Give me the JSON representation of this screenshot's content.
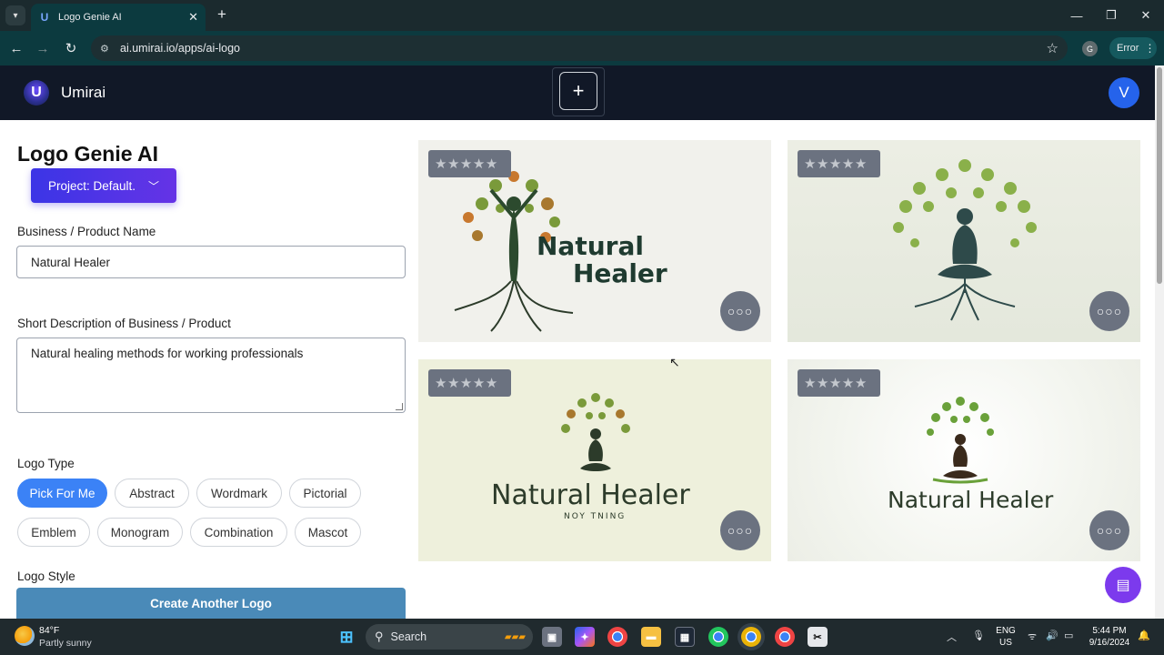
{
  "browser": {
    "tab_title": "Logo Genie AI",
    "url": "ai.umirai.io/apps/ai-logo",
    "profile_initial": "G",
    "error_label": "Error"
  },
  "header": {
    "brand": "Umirai",
    "brand_mark": "U",
    "new_label": "+",
    "avatar_initial": "V"
  },
  "form": {
    "title": "Logo Genie AI",
    "project_label": "Project: Default.",
    "name_label": "Business / Product Name",
    "name_value": "Natural Healer",
    "desc_label": "Short Description of Business / Product",
    "desc_value": "Natural healing methods for working professionals",
    "type_label": "Logo Type",
    "types": [
      "Pick For Me",
      "Abstract",
      "Wordmark",
      "Pictorial",
      "Emblem",
      "Monogram",
      "Combination",
      "Mascot"
    ],
    "selected_type": "Pick For Me",
    "style_label": "Logo Style",
    "create_label": "Create Another Logo"
  },
  "logos": [
    {
      "rating": 0,
      "line1": "Natural",
      "line2": "Healer",
      "tagline": ""
    },
    {
      "rating": 0,
      "line1": "",
      "line2": "",
      "tagline": ""
    },
    {
      "rating": 0,
      "line1": "Natural Healer",
      "line2": "",
      "tagline": "NOY TNING"
    },
    {
      "rating": 0,
      "line1": "Natural Healer",
      "line2": "",
      "tagline": ""
    }
  ],
  "taskbar": {
    "temperature": "84°F",
    "weather": "Partly sunny",
    "search_placeholder": "Search",
    "lang_line1": "ENG",
    "lang_line2": "US",
    "time": "5:44 PM",
    "date": "9/16/2024"
  },
  "colors": {
    "accent": "#3b82f6",
    "project_button": "#4f35e6",
    "create_button": "#4a8ab8",
    "header_bg": "#111827",
    "chat_fab": "#7c3aed"
  }
}
